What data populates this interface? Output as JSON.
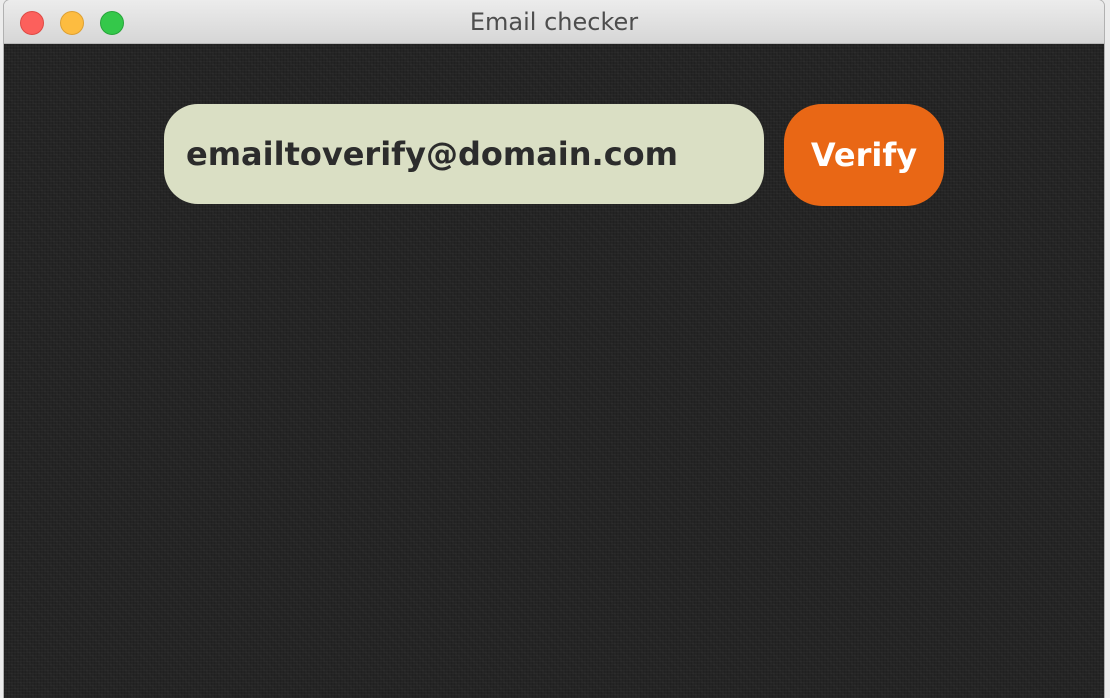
{
  "window": {
    "title": "Email checker"
  },
  "form": {
    "email_value": "emailtoverify@domain.com",
    "verify_label": "Verify"
  },
  "colors": {
    "background": "#242424",
    "input_background": "#dadfc4",
    "button_accent": "#e96715",
    "button_text": "#ffffff"
  }
}
